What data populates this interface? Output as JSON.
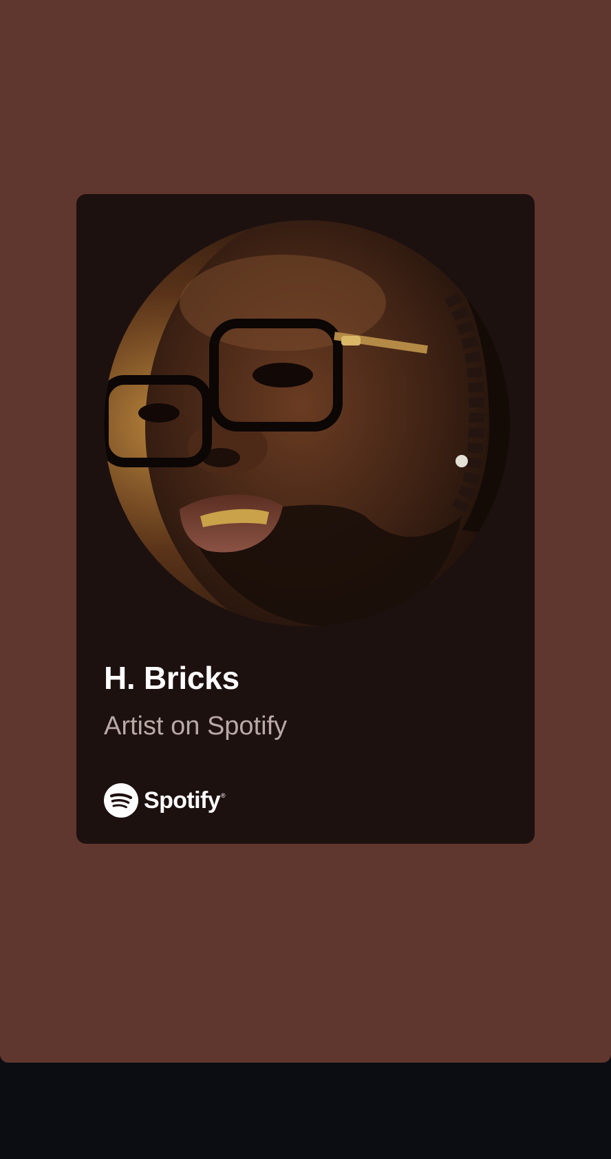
{
  "share_card": {
    "artist_name": "H. Bricks",
    "subtitle": "Artist on Spotify",
    "brand": {
      "wordmark": "Spotify",
      "icon": "spotify-logo-icon"
    }
  },
  "colors": {
    "screen_background": "#60372e",
    "card_background": "#1d1110",
    "name_text": "#ffffff",
    "subtitle_text": "#b9aaa7",
    "nav_bar": "#0b0d12"
  }
}
